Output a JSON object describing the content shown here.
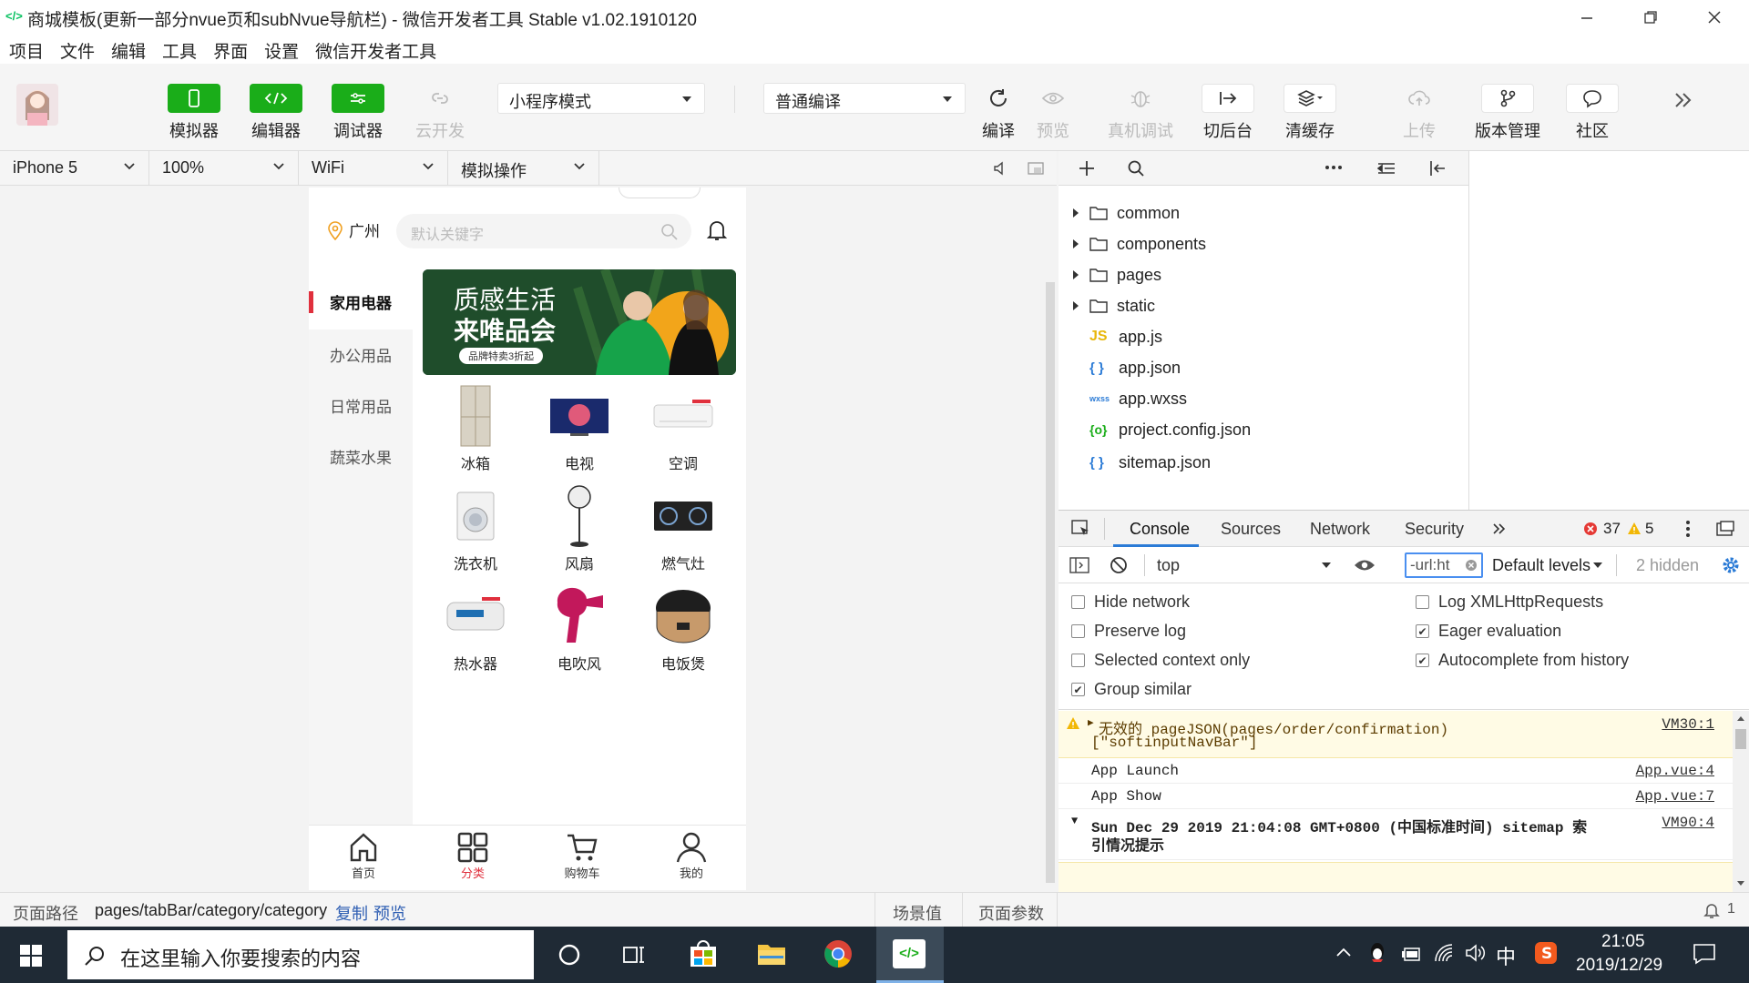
{
  "window": {
    "title": "商城模板(更新一部分nvue页和subNvue导航栏) - 微信开发者工具 Stable v1.02.1910120",
    "app_icon": "</>"
  },
  "menubar": [
    "项目",
    "文件",
    "编辑",
    "工具",
    "界面",
    "设置",
    "微信开发者工具"
  ],
  "toolbar": {
    "simulator": "模拟器",
    "editor": "编辑器",
    "debugger": "调试器",
    "cloud": "云开发",
    "mode": "小程序模式",
    "compile_mode": "普通编译",
    "compile": "编译",
    "preview": "预览",
    "remote_debug": "真机调试",
    "background": "切后台",
    "clear_cache": "清缓存",
    "upload": "上传",
    "version": "版本管理",
    "community": "社区"
  },
  "devicebar": {
    "device": "iPhone 5",
    "zoom": "100%",
    "network": "WiFi",
    "operation": "模拟操作"
  },
  "phone": {
    "location": "广州",
    "search_placeholder": "默认关键字",
    "categories": [
      "家用电器",
      "办公用品",
      "日常用品",
      "蔬菜水果"
    ],
    "banner_line1": "质感生活",
    "banner_line2": "来唯品会",
    "banner_tag": "品牌特卖3折起",
    "products": [
      "冰箱",
      "电视",
      "空调",
      "洗衣机",
      "风扇",
      "燃气灶",
      "热水器",
      "电吹风",
      "电饭煲"
    ],
    "tabs": [
      "首页",
      "分类",
      "购物车",
      "我的"
    ]
  },
  "statusbar": {
    "path_label": "页面路径",
    "path": "pages/tabBar/category/category",
    "copy": "复制",
    "preview": "预览",
    "scene": "场景值",
    "params": "页面参数",
    "notify_count": "1"
  },
  "files": [
    {
      "name": "common",
      "type": "folder"
    },
    {
      "name": "components",
      "type": "folder"
    },
    {
      "name": "pages",
      "type": "folder"
    },
    {
      "name": "static",
      "type": "folder"
    },
    {
      "name": "app.js",
      "type": "js",
      "badge": "JS"
    },
    {
      "name": "app.json",
      "type": "json",
      "badge": "{ }"
    },
    {
      "name": "app.wxss",
      "type": "wxss",
      "badge": "wxss"
    },
    {
      "name": "project.config.json",
      "type": "config",
      "badge": "{o}"
    },
    {
      "name": "sitemap.json",
      "type": "json",
      "badge": "{ }"
    }
  ],
  "devtools": {
    "tabs": [
      "Console",
      "Sources",
      "Network",
      "Security"
    ],
    "error_count": "37",
    "warn_count": "5",
    "context": "top",
    "filter_value": "-url:ht",
    "levels": "Default levels",
    "hidden": "2 hidden",
    "options_left": [
      "Hide network",
      "Preserve log",
      "Selected context only",
      "Group similar"
    ],
    "options_left_checked": [
      false,
      false,
      false,
      true
    ],
    "options_right": [
      "Log XMLHttpRequests",
      "Eager evaluation",
      "Autocomplete from history"
    ],
    "options_right_checked": [
      false,
      true,
      true
    ],
    "logs": [
      {
        "text": "无效的 pageJSON(pages/order/confirmation)",
        "text2": "[\"softinputNavBar\"]",
        "src": "VM30:1",
        "level": "warn"
      },
      {
        "text": "App Launch",
        "src": "App.vue:4",
        "level": "info"
      },
      {
        "text": "App Show",
        "src": "App.vue:7",
        "level": "info"
      },
      {
        "text": "Sun Dec 29 2019 21:04:08 GMT+0800 (中国标准时间) sitemap 索",
        "text2": "引情况提示",
        "src": "VM90:4",
        "level": "info"
      }
    ]
  },
  "taskbar": {
    "search_placeholder": "在这里输入你要搜索的内容",
    "time": "21:05",
    "date": "2019/12/29",
    "ime": "中"
  },
  "colors": {
    "green": "#1aad19",
    "red_accent": "#e0303d",
    "taskbar": "#1f2a35"
  }
}
